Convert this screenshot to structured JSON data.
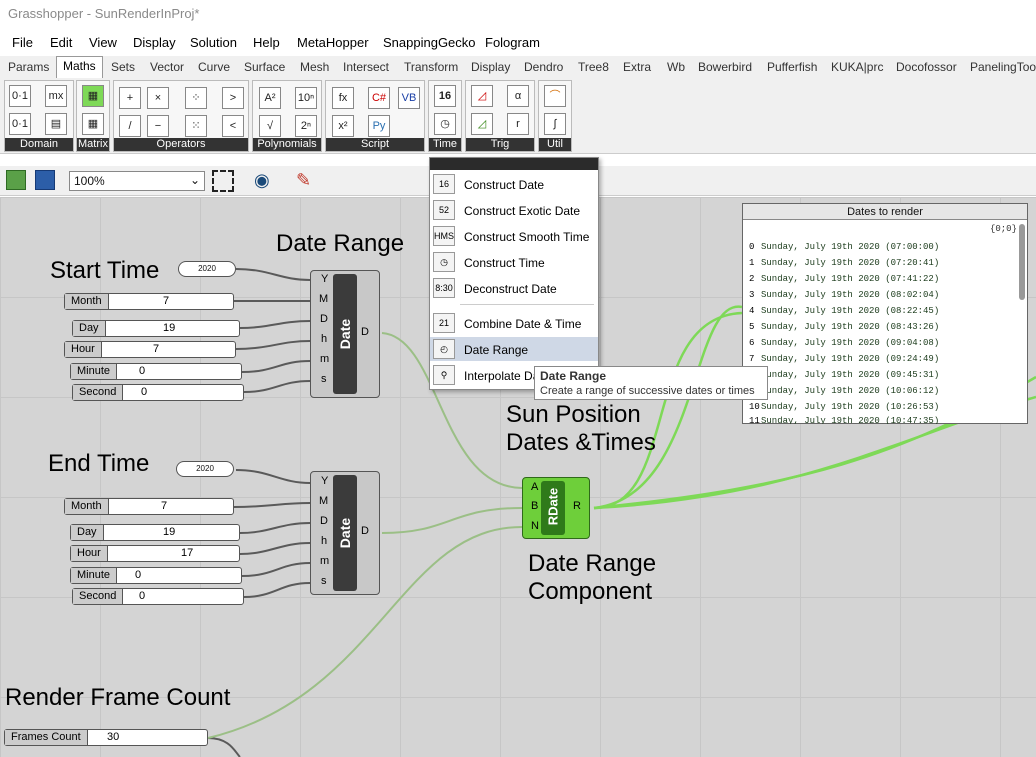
{
  "app": {
    "title": "Grasshopper - SunRenderInProj*"
  },
  "menu": [
    "File",
    "Edit",
    "View",
    "Display",
    "Solution",
    "Help",
    "MetaHopper",
    "SnappingGecko",
    "Fologram"
  ],
  "tabs": [
    "Params",
    "Maths",
    "Sets",
    "Vector",
    "Curve",
    "Surface",
    "Mesh",
    "Intersect",
    "Transform",
    "Display",
    "Dendro",
    "Tree8",
    "Extra",
    "Wb",
    "Bowerbird",
    "Pufferfish",
    "KUKA|prc",
    "Docofossor",
    "PanelingTools"
  ],
  "active_tab": "Maths",
  "ribbon_groups": [
    "Domain",
    "Matrix",
    "Operators",
    "Polynomials",
    "Script",
    "Time",
    "Trig",
    "Util"
  ],
  "toolbar": {
    "zoom": "100%"
  },
  "dropdown": {
    "items": [
      "Construct Date",
      "Construct Exotic Date",
      "Construct Smooth Time",
      "Construct Time",
      "Deconstruct Date",
      "Combine Date & Time",
      "Date Range",
      "Interpolate Da"
    ],
    "icons": [
      "16",
      "52",
      "HMS",
      "◷",
      "8:30",
      "21",
      "◴",
      "⚲"
    ],
    "selected": "Date Range"
  },
  "tooltip": {
    "title": "Date Range",
    "description": "Create a range of successive dates or times"
  },
  "labels": {
    "start_time": "Start Time",
    "date_range": "Date Range",
    "end_time": "End Time",
    "sun_position": "Sun Position",
    "dates_times": "Dates &Times",
    "date_range_component": "Date Range",
    "date_range_component2": "Component",
    "render_frame_count": "Render Frame Count"
  },
  "start": {
    "year": "2020",
    "month": {
      "name": "Month",
      "value": "7"
    },
    "day": {
      "name": "Day",
      "value": "19"
    },
    "hour": {
      "name": "Hour",
      "value": "7"
    },
    "minute": {
      "name": "Minute",
      "value": "0"
    },
    "second": {
      "name": "Second",
      "value": "0"
    }
  },
  "end": {
    "year": "2020",
    "month": {
      "name": "Month",
      "value": "7"
    },
    "day": {
      "name": "Day",
      "value": "19"
    },
    "hour": {
      "name": "Hour",
      "value": "17"
    },
    "minute": {
      "name": "Minute",
      "value": "0"
    },
    "second": {
      "name": "Second",
      "value": "0"
    }
  },
  "construct_date": {
    "name": "Date",
    "inputs": [
      "Y",
      "M",
      "D",
      "h",
      "m",
      "s"
    ],
    "output": "D"
  },
  "rdate": {
    "name": "RDate",
    "inputs": [
      "A",
      "B",
      "N"
    ],
    "output": "R"
  },
  "frames": {
    "name": "Frames Count",
    "value": "30"
  },
  "panel": {
    "title": "Dates to render",
    "path": "{0;0}",
    "rows": [
      {
        "i": "0",
        "t": "Sunday, July 19th 2020 (07:00:00)"
      },
      {
        "i": "1",
        "t": "Sunday, July 19th 2020 (07:20:41)"
      },
      {
        "i": "2",
        "t": "Sunday, July 19th 2020 (07:41:22)"
      },
      {
        "i": "3",
        "t": "Sunday, July 19th 2020 (08:02:04)"
      },
      {
        "i": "4",
        "t": "Sunday, July 19th 2020 (08:22:45)"
      },
      {
        "i": "5",
        "t": "Sunday, July 19th 2020 (08:43:26)"
      },
      {
        "i": "6",
        "t": "Sunday, July 19th 2020 (09:04:08)"
      },
      {
        "i": "7",
        "t": "Sunday, July 19th 2020 (09:24:49)"
      },
      {
        "i": "8",
        "t": "Sunday, July 19th 2020 (09:45:31)"
      },
      {
        "i": "9",
        "t": "Sunday, July 19th 2020 (10:06:12)"
      },
      {
        "i": "10",
        "t": "Sunday, July 19th 2020 (10:26:53)"
      },
      {
        "i": "11",
        "t": "Sunday, July 19th 2020 (10:47:35)"
      }
    ]
  },
  "colors": {
    "wire_green": "#7ed957",
    "wire_grey": "#5a5a5a",
    "component_green": "#6ecf3a",
    "selection": "#cfd8e6"
  }
}
